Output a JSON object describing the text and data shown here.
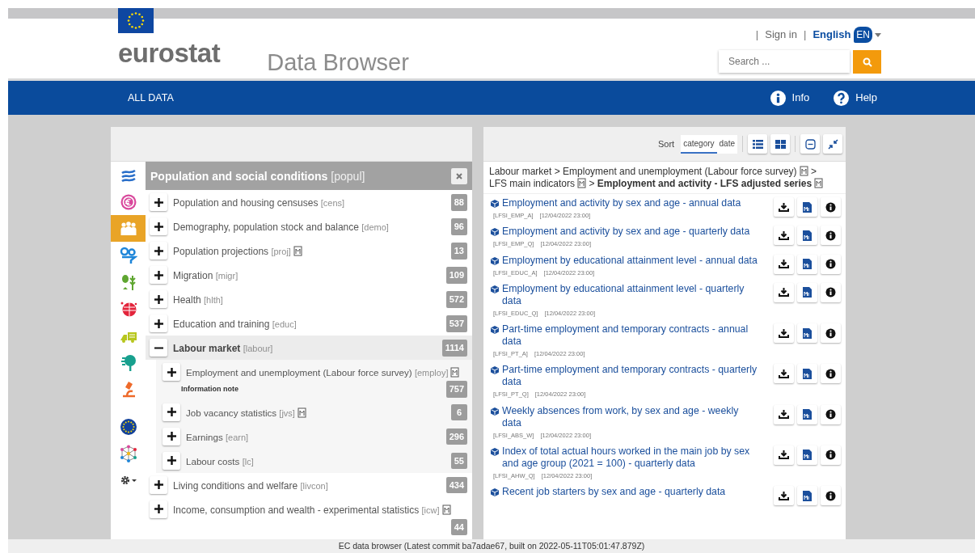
{
  "header": {
    "logo": "eurostat",
    "app_title": "Data Browser",
    "links": [
      {
        "kind": "signin",
        "separator": "|",
        "label": "Sign in"
      },
      {
        "kind": "language",
        "separator": "|",
        "label": "English",
        "code": "EN"
      }
    ],
    "search": {
      "placeholder": "Search ..."
    }
  },
  "nav": {
    "items": [
      {
        "label": "ALL DATA"
      }
    ],
    "actions": [
      {
        "kind": "info",
        "label": "Info"
      },
      {
        "kind": "help",
        "label": "Help"
      }
    ]
  },
  "themes": [
    {
      "kind": "general",
      "selected": false
    },
    {
      "kind": "economy",
      "selected": false
    },
    {
      "kind": "population",
      "selected": true
    },
    {
      "kind": "industry",
      "selected": false
    },
    {
      "kind": "agriculture",
      "selected": false
    },
    {
      "kind": "trade",
      "selected": false
    },
    {
      "kind": "transport",
      "selected": false
    },
    {
      "kind": "environment",
      "selected": false
    },
    {
      "kind": "science",
      "selected": false
    },
    {
      "kind": "eu",
      "selected": false
    },
    {
      "kind": "cross",
      "selected": false
    },
    {
      "kind": "settings",
      "selected": false
    }
  ],
  "category": {
    "title": "Population and social conditions",
    "code": "[popul]"
  },
  "tree": [
    {
      "label": "Population and housing censuses",
      "code": "[cens]",
      "metadata": false,
      "count": "88",
      "expanded": false
    },
    {
      "label": "Demography, population stock and balance",
      "code": "[demo]",
      "metadata": false,
      "count": "96",
      "expanded": false
    },
    {
      "label": "Population projections",
      "code": "[proj]",
      "metadata": true,
      "count": "13",
      "expanded": false
    },
    {
      "label": "Migration",
      "code": "[migr]",
      "metadata": false,
      "count": "109",
      "expanded": false
    },
    {
      "label": "Health",
      "code": "[hlth]",
      "metadata": false,
      "count": "572",
      "expanded": false
    },
    {
      "label": "Education and training",
      "code": "[educ]",
      "metadata": false,
      "count": "537",
      "expanded": false
    },
    {
      "label": "Labour market",
      "code": "[labour]",
      "metadata": false,
      "count": "1114",
      "expanded": true,
      "children": [
        {
          "label": "Employment and unemployment (Labour force survey)",
          "code": "[employ]",
          "metadata": true,
          "note": "Information note",
          "count": "757",
          "expanded": false
        },
        {
          "label": "Job vacancy statistics",
          "code": "[jvs]",
          "metadata": true,
          "count": "6",
          "expanded": false
        },
        {
          "label": "Earnings",
          "code": "[earn]",
          "metadata": false,
          "count": "296",
          "expanded": false
        },
        {
          "label": "Labour costs",
          "code": "[lc]",
          "metadata": false,
          "count": "55",
          "expanded": false
        }
      ]
    },
    {
      "label": "Living conditions and welfare",
      "code": "[livcon]",
      "metadata": false,
      "count": "434",
      "expanded": false
    },
    {
      "label": "Income, consumption and wealth - experimental statistics",
      "code": "[icw]",
      "metadata": true,
      "count": "44",
      "expanded": false
    }
  ],
  "results": {
    "sort_label": "Sort",
    "sort_options": [
      {
        "label": "category",
        "selected": true
      },
      {
        "label": "date",
        "selected": false
      }
    ],
    "tools": [
      {
        "kind": "list"
      },
      {
        "kind": "grid"
      },
      {
        "kind": "collapse"
      },
      {
        "kind": "compress"
      }
    ],
    "breadcrumb": [
      {
        "label": "Labour market",
        "metadata": false,
        "current": false
      },
      {
        "separator": ">",
        "label": "Employment and unemployment (Labour force survey)",
        "metadata": true,
        "current": false
      },
      {
        "separator": ">",
        "label": "LFS main indicators",
        "metadata": true,
        "current": false
      },
      {
        "separator": ">",
        "label": "Employment and activity - LFS adjusted series",
        "metadata": true,
        "current": true
      }
    ],
    "row_actions": [
      {
        "kind": "download"
      },
      {
        "kind": "metadata"
      },
      {
        "kind": "info"
      }
    ],
    "datasets": [
      {
        "title": "Employment and activity by sex and age - annual data",
        "code": "[LFSI_EMP_A]",
        "date": "[12/04/2022 23:00]"
      },
      {
        "title": "Employment and activity by sex and age - quarterly data",
        "code": "[LFSI_EMP_Q]",
        "date": "[12/04/2022 23:00]"
      },
      {
        "title": "Employment by educational attainment level - annual data",
        "code": "[LFSI_EDUC_A]",
        "date": "[12/04/2022 23:00]"
      },
      {
        "title": "Employment by educational attainment level - quarterly data",
        "code": "[LFSI_EDUC_Q]",
        "date": "[12/04/2022 23:00]"
      },
      {
        "title": "Part-time employment and temporary contracts - annual data",
        "code": "[LFSI_PT_A]",
        "date": "[12/04/2022 23:00]"
      },
      {
        "title": "Part-time employment and temporary contracts - quarterly data",
        "code": "[LFSI_PT_Q]",
        "date": "[12/04/2022 23:00]"
      },
      {
        "title": "Weekly absences from work, by sex and age - weekly data",
        "code": "[LFSI_ABS_W]",
        "date": "[12/04/2022 23:00]"
      },
      {
        "title": "Index of total actual hours worked in the main job by sex and age group (2021 = 100) - quarterly data",
        "code": "[LFSI_AHW_Q]",
        "date": "[12/04/2022 23:00]"
      },
      {
        "title": "Recent job starters by sex and age - quarterly data"
      }
    ]
  },
  "footer": "EC data browser (Latest commit ba7adae67, built on 2022-05-11T05:01:47.879Z)"
}
